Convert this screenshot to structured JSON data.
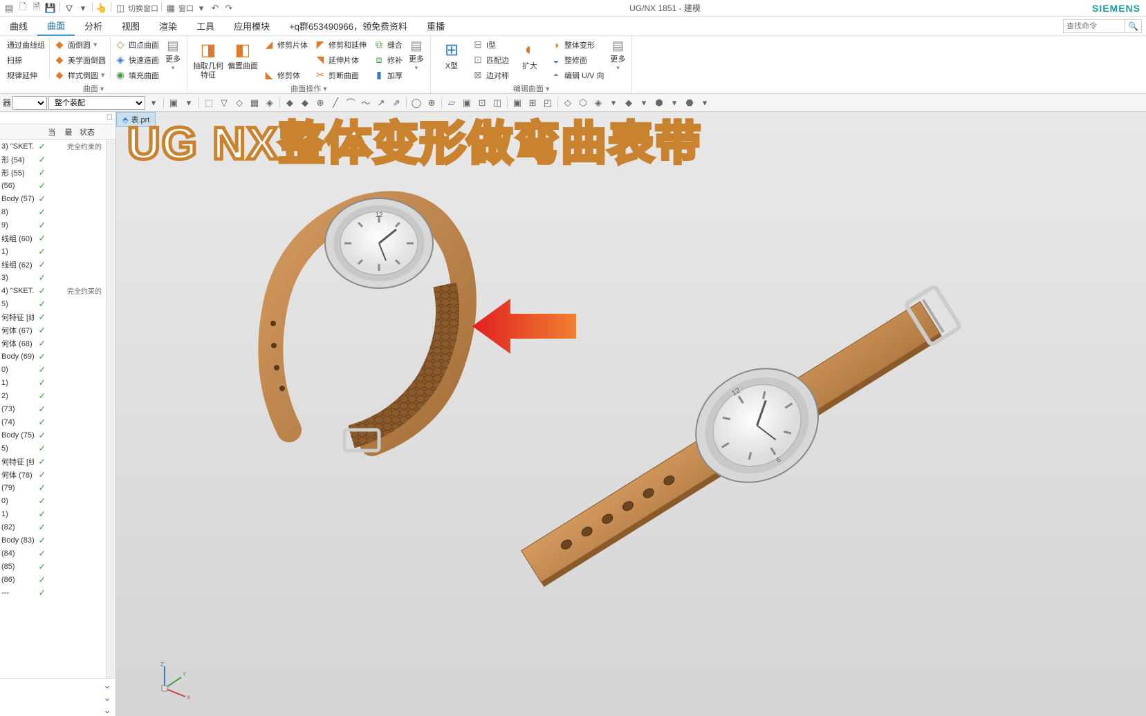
{
  "app": {
    "title": "UG/NX 1851 - 建模",
    "brand": "SIEMENS"
  },
  "qat": {
    "switch_window": "切换窗口",
    "window": "窗口"
  },
  "menu": {
    "items": [
      "曲线",
      "曲面",
      "分析",
      "视图",
      "渲染",
      "工具",
      "应用模块",
      "+q群653490966，领免费资料",
      "重播"
    ],
    "active_index": 1,
    "search_placeholder": "查找命令"
  },
  "ribbon": {
    "groups": [
      {
        "label": "曲面",
        "col1": [
          "通过曲线组",
          "扫掠",
          "规律延伸"
        ],
        "col2": [
          {
            "label": "面倒圆",
            "color": "orange"
          },
          {
            "label": "美学面倒圆",
            "color": "orange"
          },
          {
            "label": "样式倒圆",
            "color": "orange"
          }
        ],
        "col3": [
          {
            "label": "四点曲面",
            "color": "orange"
          },
          {
            "label": "快速造面",
            "color": "blue"
          },
          {
            "label": "填充曲面",
            "color": "green"
          }
        ],
        "more": "更多"
      },
      {
        "label": "曲面操作",
        "big": [
          {
            "label": "抽取几何特征",
            "color": "orange"
          },
          {
            "label": "偏置曲面",
            "color": "orange"
          }
        ],
        "col1": [
          {
            "label": "修剪片体",
            "color": "orange"
          },
          {
            "label": "",
            "color": ""
          },
          {
            "label": "修剪体",
            "color": "orange"
          }
        ],
        "col2": [
          {
            "label": "修剪和延伸",
            "color": "orange"
          },
          {
            "label": "延伸片体",
            "color": "orange"
          },
          {
            "label": "剪断曲面",
            "color": "orange"
          }
        ],
        "col3": [
          {
            "label": "缝合",
            "color": "green"
          },
          {
            "label": "修补",
            "color": "green"
          },
          {
            "label": "加厚",
            "color": "blue"
          }
        ],
        "more": "更多"
      },
      {
        "label": "编辑曲面",
        "big": [
          {
            "label": "X型",
            "color": "blue"
          },
          {
            "label": "扩大",
            "color": "orange"
          }
        ],
        "col1": [
          {
            "label": "I型",
            "color": "gray"
          },
          {
            "label": "匹配边",
            "color": "gray"
          },
          {
            "label": "边对称",
            "color": "gray"
          }
        ],
        "col2": [
          {
            "label": "整体变形",
            "color": "orange"
          },
          {
            "label": "整修面",
            "color": "blue"
          },
          {
            "label": "编辑 U/V 向",
            "color": "gray"
          }
        ],
        "more": "更多"
      }
    ]
  },
  "toolbar": {
    "filter_label": "器",
    "assembly": "整个装配"
  },
  "tree": {
    "headers": {
      "c1": "",
      "c2": "当",
      "c3": "最",
      "c4": "状态"
    },
    "rows": [
      {
        "name": "3) \"SKET...",
        "status": "完全约束的"
      },
      {
        "name": "形 (54)"
      },
      {
        "name": "形 (55)"
      },
      {
        "name": "(56)"
      },
      {
        "name": "Body (57)"
      },
      {
        "name": "8)"
      },
      {
        "name": "9)"
      },
      {
        "name": "线组 (60)"
      },
      {
        "name": "1)"
      },
      {
        "name": "线组 (62)"
      },
      {
        "name": "3)"
      },
      {
        "name": "4) \"SKET...",
        "status": "完全约束的"
      },
      {
        "name": "5)"
      },
      {
        "name": "何特征 [线..."
      },
      {
        "name": "何体 (67)"
      },
      {
        "name": "何体 (68)"
      },
      {
        "name": "Body (69)"
      },
      {
        "name": "0)"
      },
      {
        "name": "1)"
      },
      {
        "name": "2)"
      },
      {
        "name": "(73)"
      },
      {
        "name": "(74)"
      },
      {
        "name": "Body (75)"
      },
      {
        "name": "5)"
      },
      {
        "name": "何特征 [线..."
      },
      {
        "name": "何体 (78)"
      },
      {
        "name": "(79)"
      },
      {
        "name": "0)"
      },
      {
        "name": "1)"
      },
      {
        "name": "(82)"
      },
      {
        "name": "Body (83)"
      },
      {
        "name": "(84)"
      },
      {
        "name": "(85)"
      },
      {
        "name": "(86)"
      },
      {
        "name": "---"
      }
    ]
  },
  "viewport": {
    "file_tab": "表.prt",
    "overlay_text": "UG NX整体变形做弯曲表带"
  }
}
